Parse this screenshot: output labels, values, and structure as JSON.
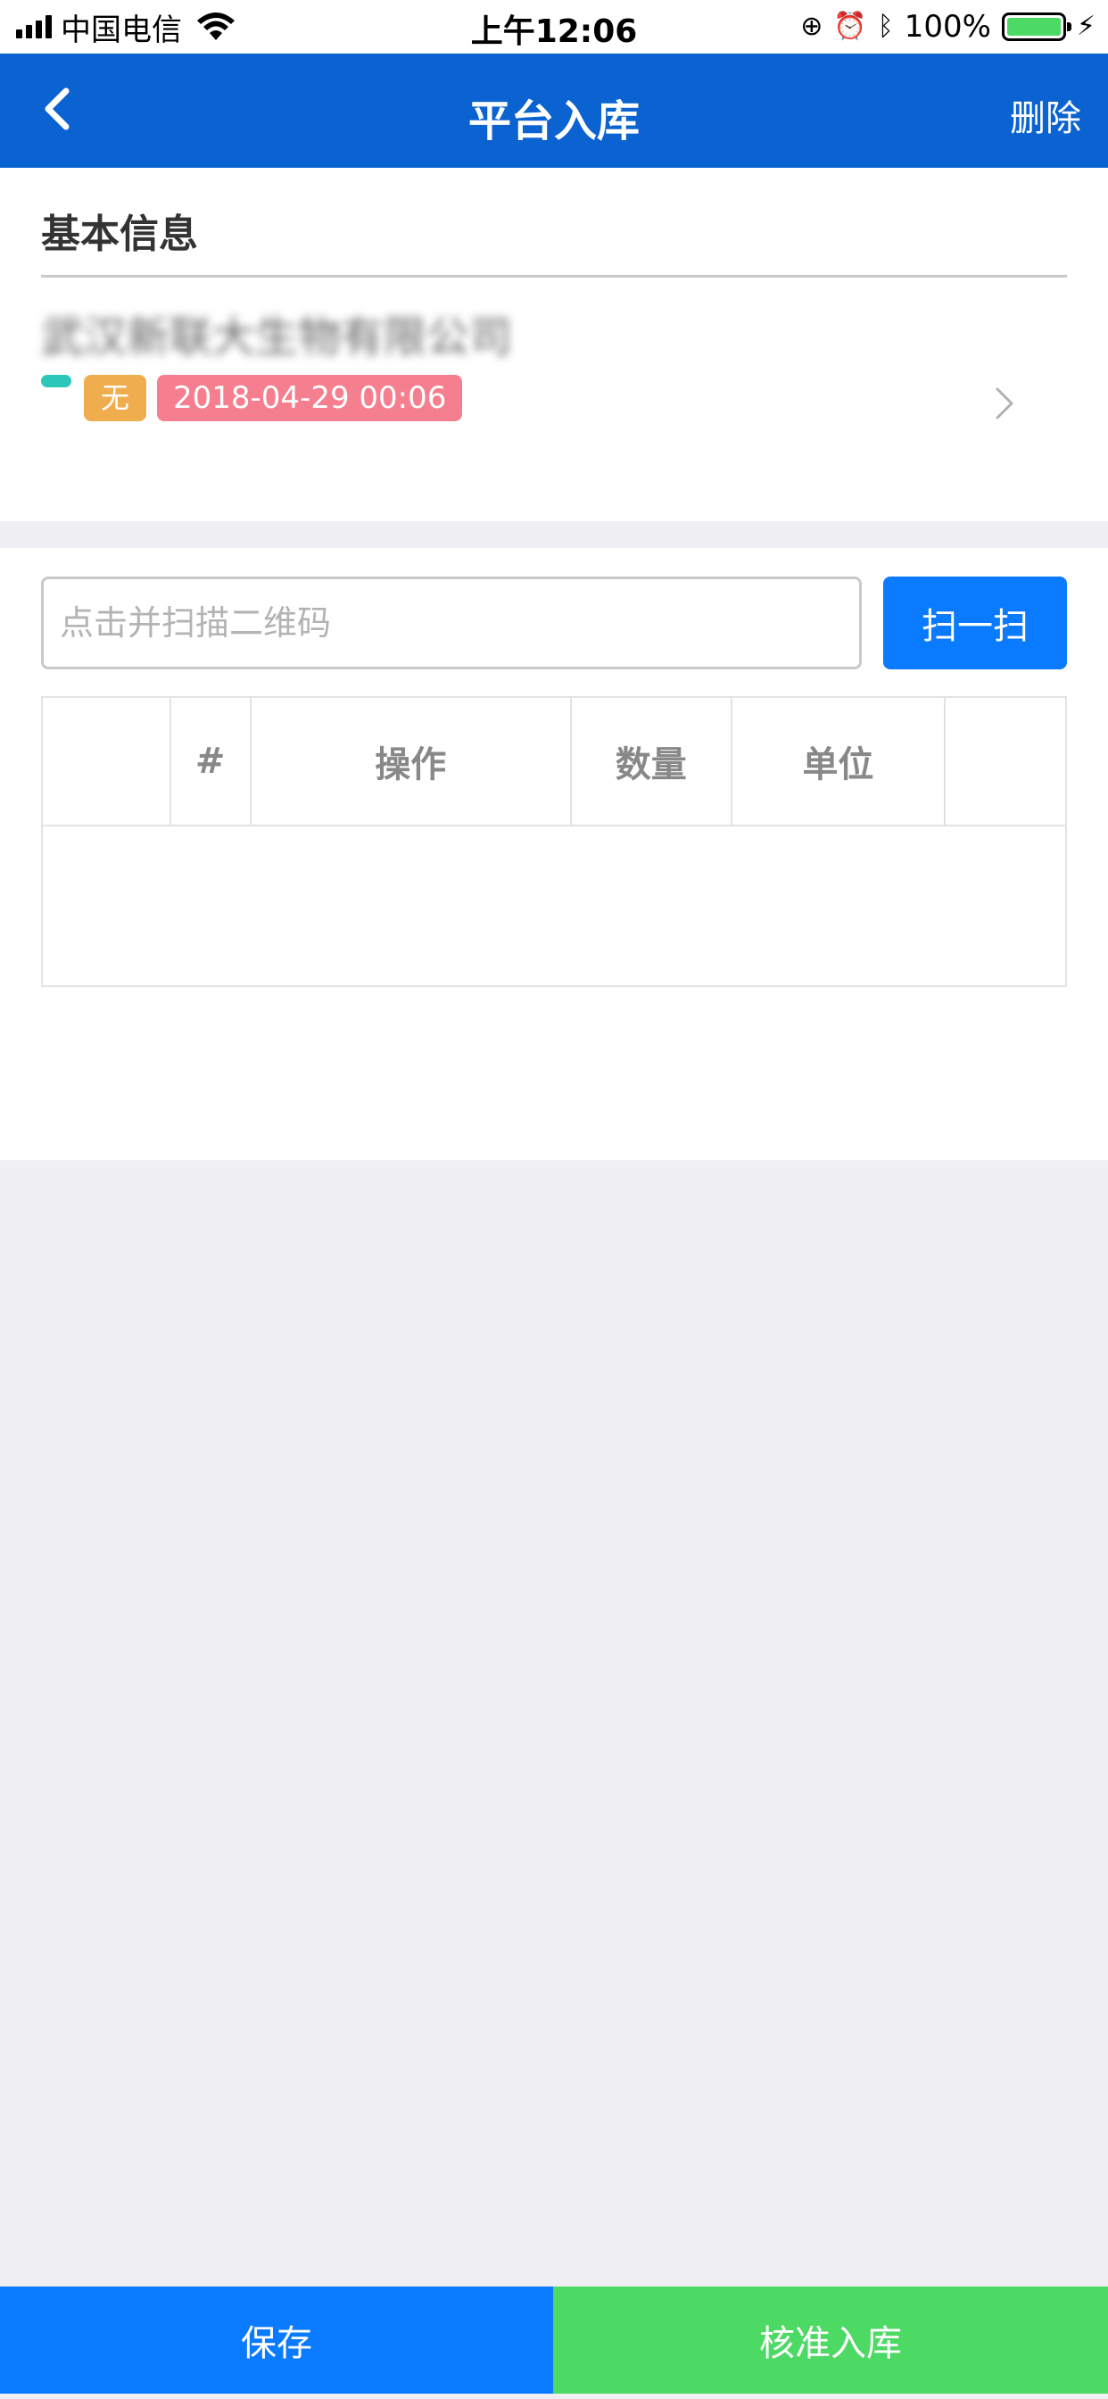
{
  "status_bar": {
    "carrier": "中国电信",
    "time": "上午12:06",
    "battery_percent": "100%",
    "battery_color": "#4cd964"
  },
  "nav": {
    "title": "平台入库",
    "right_action": "删除",
    "background": "#0b63d1"
  },
  "basic_info": {
    "section_title": "基本信息",
    "company_name": "武汉新联大生物有限公司",
    "tag_label": "无",
    "date_label": "2018-04-29 00:06"
  },
  "scan": {
    "placeholder": "点击并扫描二维码",
    "button_label": "扫一扫"
  },
  "table": {
    "columns": [
      "",
      "#",
      "操作",
      "数量",
      "单位",
      ""
    ],
    "rows": []
  },
  "footer": {
    "save_label": "保存",
    "approve_label": "核准入库",
    "save_color": "#0a7aff",
    "approve_color": "#4cd964"
  }
}
